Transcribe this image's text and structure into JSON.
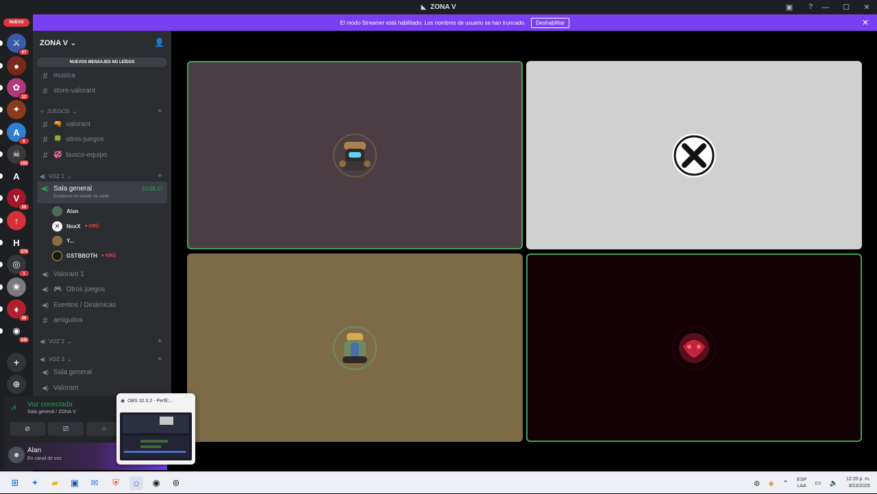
{
  "window": {
    "title": "ZONA V"
  },
  "rail": {
    "new_label": "NUEVO",
    "guilds": [
      {
        "name": "guild-1",
        "badge": "97",
        "color": "#3b5aa8",
        "glyph": "⚔"
      },
      {
        "name": "guild-2",
        "badge": "",
        "color": "#7a2a1c",
        "glyph": "●"
      },
      {
        "name": "guild-3",
        "badge": "12",
        "color": "#b33a79",
        "glyph": "✿"
      },
      {
        "name": "guild-4",
        "badge": "",
        "color": "#8a3b1c",
        "glyph": "✦"
      },
      {
        "name": "guild-5",
        "badge": "6",
        "color": "#2f7fd1",
        "glyph": "A"
      },
      {
        "name": "guild-6",
        "badge": "183",
        "color": "#3a3a3a",
        "glyph": "☠"
      },
      {
        "name": "guild-7",
        "badge": "",
        "color": "#1e1f22",
        "glyph": "A"
      },
      {
        "name": "guild-8",
        "badge": "20",
        "color": "#a3162b",
        "glyph": "V"
      },
      {
        "name": "guild-9",
        "badge": "",
        "color": "#d6303b",
        "glyph": "↑"
      },
      {
        "name": "guild-10",
        "badge": "374",
        "color": "#1e1f22",
        "glyph": "H"
      },
      {
        "name": "guild-11",
        "badge": "1",
        "color": "#35373c",
        "glyph": "◎"
      },
      {
        "name": "guild-12",
        "badge": "",
        "color": "#7b7b7b",
        "glyph": "❀"
      },
      {
        "name": "guild-13",
        "badge": "36",
        "color": "#b0202f",
        "glyph": "♦"
      },
      {
        "name": "guild-14",
        "badge": "345",
        "color": "#1e1f22",
        "glyph": "◉"
      }
    ]
  },
  "banner": {
    "text": "El modo Streamer está habilitado. Los nombres de usuario se han truncado.",
    "button": "Deshabilitar"
  },
  "sidebar": {
    "server_name": "ZONA V",
    "unread_pill": "NUEVOS MENSAJES NO LEÍDOS",
    "channels_top": [
      {
        "label": "musica"
      },
      {
        "label": "store-valorant"
      }
    ],
    "cat_juegos": "JUEGOS",
    "juegos": [
      {
        "label": "valorant",
        "emoji": "🔫"
      },
      {
        "label": "otros-juegos",
        "emoji": "🍀"
      },
      {
        "label": "busco-equipo",
        "emoji": "💞"
      }
    ],
    "cat_voz1": "VOZ 1",
    "active_voice": {
      "name": "Sala general",
      "status": "Establecer un estado de canal",
      "timer": "10:08:17"
    },
    "voice_users": [
      {
        "name": "Alan",
        "tag": "",
        "avatar_color": "#4f6b54"
      },
      {
        "name": "NoxX",
        "tag": "KRÜ",
        "avatar_color": "#f2f3f5"
      },
      {
        "name": "Y...",
        "tag": "",
        "avatar_color": "#8b6d3e"
      },
      {
        "name": "GSTBBOTH",
        "tag": "KRÜ",
        "avatar_color": "#1b1b14"
      }
    ],
    "voice1_channels": [
      {
        "label": "Valorant 1"
      },
      {
        "label": "Otros juegos",
        "emoji": "🎮"
      },
      {
        "label": "Eventos / Dinámicas"
      },
      {
        "label": "amiguitos"
      }
    ],
    "cat_voz2": "VOZ 2",
    "cat_voz3": "VOZ 3",
    "voice3_channels": [
      {
        "label": "Sala general"
      },
      {
        "label": "Valorant"
      }
    ]
  },
  "voice_panel": {
    "title": "Voz conectada",
    "subtitle": "Sala general / ZONA V"
  },
  "user_panel": {
    "name": "Alan",
    "status": "En canal de voz"
  },
  "obs": {
    "title": "OBS 32.0.2 - Perfil:..."
  },
  "tiles": [
    {
      "name": "tile-1",
      "bg": "#4b3d44",
      "speaking": true
    },
    {
      "name": "tile-2",
      "bg": "#d0d0d0",
      "speaking": false
    },
    {
      "name": "tile-3",
      "bg": "#7d6b48",
      "speaking": false
    },
    {
      "name": "tile-4",
      "bg": "#130106",
      "speaking": true
    }
  ],
  "taskbar": {
    "lang_top": "ESP",
    "lang_bottom": "LAA",
    "time": "12:20 p. m.",
    "date": "8/10/2025"
  }
}
